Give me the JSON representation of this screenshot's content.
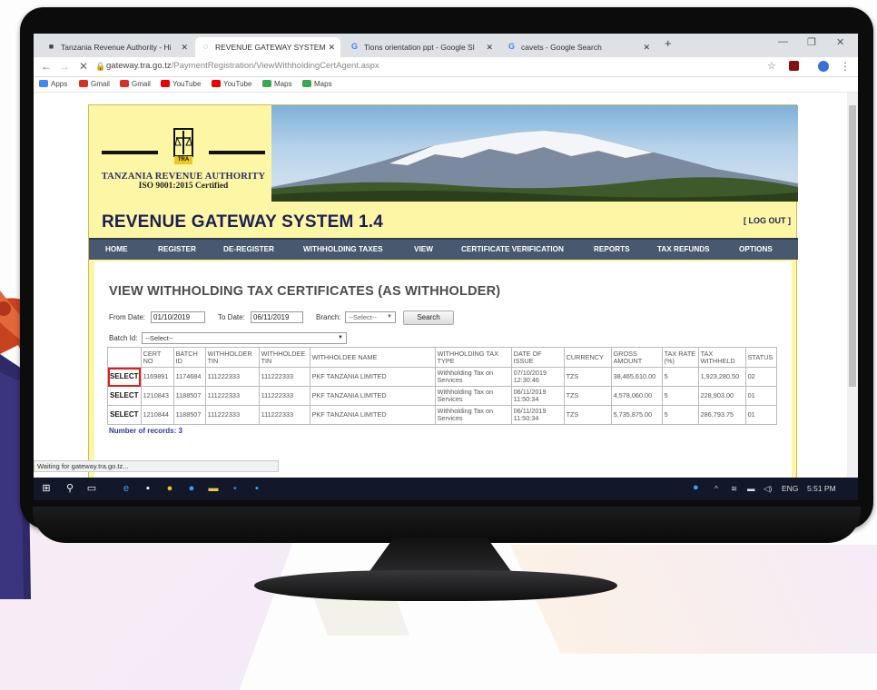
{
  "browser": {
    "tabs": [
      {
        "label": "Tanzania Revenue Authority - Hi"
      },
      {
        "label": "REVENUE GATEWAY SYSTEM"
      },
      {
        "label": "Tions orientation ppt - Google Sl"
      },
      {
        "label": "cavets - Google Search"
      }
    ],
    "url_domain": "gateway.tra.go.tz",
    "url_path": "/PaymentRegistration/ViewWithholdingCertAgent.aspx",
    "bookmarks": [
      "Apps",
      "Gmail",
      "Gmail",
      "YouTube",
      "YouTube",
      "Maps",
      "Maps"
    ],
    "status_text": "Waiting for gateway.tra.go.tz..."
  },
  "site": {
    "org_name": "TANZANIA REVENUE AUTHORITY",
    "iso": "ISO 9001:2015 Certified",
    "logo_text": "TRA",
    "system_title": "REVENUE GATEWAY SYSTEM 1.4",
    "logout": "[ LOG OUT ]",
    "menu": [
      "HOME",
      "REGISTER",
      "DE-REGISTER",
      "WITHHOLDING TAXES",
      "VIEW",
      "CERTIFICATE VERIFICATION",
      "REPORTS",
      "TAX REFUNDS",
      "OPTIONS"
    ]
  },
  "form": {
    "heading": "VIEW WITHHOLDING TAX CERTIFICATES (AS WITHHOLDER)",
    "from_label": "From Date:",
    "from_value": "01/10/2019",
    "to_label": "To Date:",
    "to_value": "06/11/2019",
    "branch_label": "Branch:",
    "branch_value": "--Select--",
    "search_label": "Search",
    "batch_label": "Batch Id:",
    "batch_value": "--Select--"
  },
  "table": {
    "headers": [
      "",
      "CERT NO",
      "BATCH ID",
      "WITHHOLDER TIN",
      "WITHHOLDEE TIN",
      "WITHHOLDEE NAME",
      "WITHHOLDING TAX TYPE",
      "DATE OF ISSUE",
      "CURRENCY",
      "GROSS AMOUNT",
      "TAX RATE (%)",
      "TAX WITHHELD",
      "STATUS"
    ],
    "rows": [
      [
        "SELECT",
        "1169891",
        "1174684",
        "111222333",
        "111222333",
        "PKF TANZANIA LIMITED",
        "Withholding Tax on Services",
        "07/10/2019 12:30:46",
        "TZS",
        "38,465,610.00",
        "5",
        "1,923,280.50",
        "02"
      ],
      [
        "SELECT",
        "1210843",
        "1188507",
        "111222333",
        "111222333",
        "PKF TANZANIA LIMITED",
        "Withholding Tax on Services",
        "06/11/2019 11:50:34",
        "TZS",
        "4,578,060.00",
        "5",
        "228,903.00",
        "01"
      ],
      [
        "SELECT",
        "1210844",
        "1188507",
        "111222333",
        "111222333",
        "PKF TANZANIA LIMITED",
        "Withholding Tax on Services",
        "06/11/2019 11:50:34",
        "TZS",
        "5,735,875.00",
        "5",
        "286,793.75",
        "01"
      ]
    ],
    "record_count": "Number of records: 3"
  },
  "taskbar": {
    "lang": "ENG",
    "time": "5:51 PM"
  },
  "colors": {
    "page_bg": "#fdf6a4",
    "menu_bg": "#47586f",
    "title_color": "#1b1f55",
    "highlight": "#e21b1b"
  }
}
